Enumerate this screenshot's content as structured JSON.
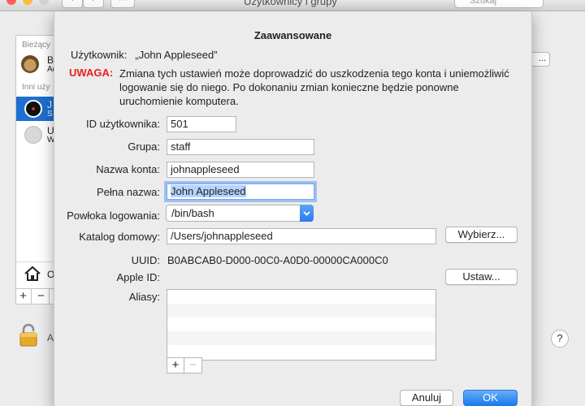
{
  "background_window": {
    "title": "Użytkownicy i grupy",
    "search_placeholder": "Szukaj",
    "nav_back": "‹",
    "nav_forward": "›",
    "grid_button": "⋯",
    "sidebar": {
      "header_current": "Bieżący",
      "header_other": "Inni uży",
      "current_user": {
        "name": "B",
        "subtitle": "Ad"
      },
      "users": [
        {
          "name": "J",
          "subtitle": "S",
          "selected": true
        },
        {
          "name": "U",
          "subtitle": "W",
          "selected": false
        }
      ],
      "home_label": "O",
      "add": "+",
      "remove": "−"
    },
    "right_button": "...",
    "lock_label": "A",
    "help": "?"
  },
  "sheet": {
    "title": "Zaawansowane",
    "user_label": "Użytkownik:",
    "user_value": "„John Appleseed”",
    "warning_label": "UWAGA:",
    "warning_text": "Zmiana tych ustawień może doprowadzić do uszkodzenia tego konta i uniemożliwić logowanie się do niego. Po dokonaniu zmian konieczne będzie ponowne uruchomienie komputera.",
    "fields": {
      "user_id": {
        "label": "ID użytkownika:",
        "value": "501"
      },
      "group": {
        "label": "Grupa:",
        "value": "staff"
      },
      "account_name": {
        "label": "Nazwa konta:",
        "value": "johnappleseed"
      },
      "full_name": {
        "label": "Pełna nazwa:",
        "value": "John Appleseed"
      },
      "login_shell": {
        "label": "Powłoka logowania:",
        "value": "/bin/bash"
      },
      "home_dir": {
        "label": "Katalog domowy:",
        "value": "/Users/johnappleseed"
      },
      "uuid": {
        "label": "UUID:",
        "value": "B0ABCAB0-D000-00C0-A0D0-00000CA000C0"
      },
      "apple_id": {
        "label": "Apple ID:",
        "value": ""
      },
      "aliases": {
        "label": "Aliasy:"
      }
    },
    "choose_button": "Wybierz...",
    "set_button": "Ustaw...",
    "alias_add": "+",
    "alias_remove": "−",
    "cancel_button": "Anuluj",
    "ok_button": "OK"
  },
  "colors": {
    "accent": "#1b7bf0",
    "warning": "#e8211f",
    "selection": "#1e6fd1"
  }
}
